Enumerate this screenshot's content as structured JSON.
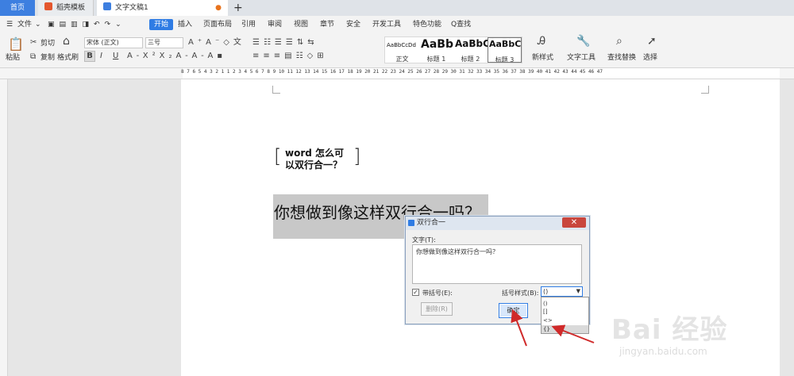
{
  "tabs": {
    "home": "首页",
    "template": "稻壳模板",
    "doc": "文字文稿1",
    "add": "+"
  },
  "menu": {
    "file": "文件",
    "start": "开始",
    "insert": "插入",
    "layout": "页面布局",
    "ref": "引用",
    "review": "审阅",
    "view": "视图",
    "chapter": "章节",
    "security": "安全",
    "dev": "开发工具",
    "special": "特色功能",
    "search": "Q查找"
  },
  "ribbon": {
    "paste": "粘贴",
    "cut": "剪切",
    "copy": "复制",
    "format_painter": "格式刷",
    "font": "宋体 (正文)",
    "size": "三号",
    "bold": "B",
    "italic": "I",
    "underline": "U",
    "styles": [
      {
        "preview": "AaBbCcDd",
        "label": "正文"
      },
      {
        "preview": "AaBb",
        "label": "标题 1"
      },
      {
        "preview": "AaBbC",
        "label": "标题 2"
      },
      {
        "preview": "AaBbC",
        "label": "标题 3"
      }
    ],
    "new_style": "新样式",
    "text_tools": "文字工具",
    "find_replace": "查找替换",
    "select": "选择"
  },
  "ruler": {
    "ticks": "8  7  6  5  4  3  2  1     1  2  3  4  5  6  7  8  9  10 11 12 13 14 15 16 17 18 19 20 21 22 23 24 25 26 27 28 29 30 31 32 33 34 35 36 37 38 39 40 41 42 43 44 45 46 47"
  },
  "document": {
    "sample_line1": "word 怎么可",
    "sample_line2": "以双行合一？",
    "bracket_left": "[",
    "bracket_right": "]",
    "selected_text": "你想做到像这样双行合一吗？"
  },
  "dialog": {
    "title": "双行合一",
    "close": "✕",
    "text_label": "文字(T):",
    "text_value": "你想做到像这样双行合一吗？",
    "check_label": "带括号(E):",
    "bracket_style_label": "括号样式(B):",
    "bracket_selected": "()",
    "bracket_options": [
      "()",
      "[]",
      "<>",
      "{}"
    ],
    "delete_button": "删除(R)",
    "ok_button": "确定"
  },
  "watermark": {
    "logo": "Bai 经验",
    "url": "jingyan.baidu.com"
  },
  "colors": {
    "accent": "#2f7ce4",
    "close_red": "#c9463d",
    "arrow_red": "#d02a2a"
  }
}
